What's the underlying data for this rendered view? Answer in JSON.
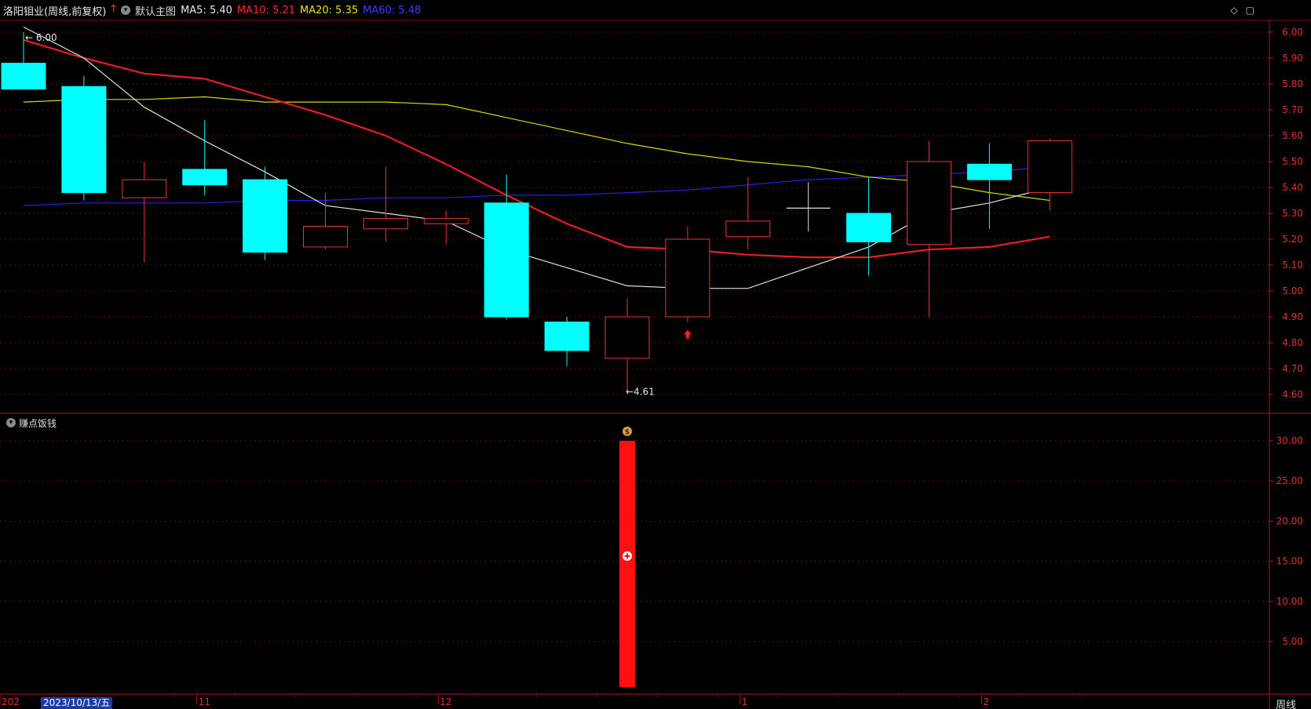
{
  "header": {
    "title": "洛阳钼业(周线,前复权)",
    "template": "默认主图",
    "ma": [
      {
        "label": "MA5: 5.40",
        "color": "#e8e8e8"
      },
      {
        "label": "MA10: 5.21",
        "color": "#ff2a2a"
      },
      {
        "label": "MA20: 5.35",
        "color": "#e6e600"
      },
      {
        "label": "MA60: 5.48",
        "color": "#2b2bff"
      }
    ]
  },
  "sub_header": {
    "title": "赚点饭钱"
  },
  "period_label": "周线",
  "date_cursor": "2023/10/13/五",
  "x_axis": {
    "labels": [
      "202",
      "11",
      "12",
      "1",
      "2"
    ]
  },
  "main_chart": {
    "y_ticks": [
      "6.00",
      "5.90",
      "5.80",
      "5.70",
      "5.60",
      "5.50",
      "5.40",
      "5.30",
      "5.20",
      "5.10",
      "5.00",
      "4.90",
      "4.80",
      "4.70",
      "4.60"
    ],
    "high_label": "6.00",
    "low_label": "4.61"
  },
  "sub_chart": {
    "y_ticks": [
      "30.00",
      "25.00",
      "20.00",
      "15.00",
      "10.00",
      "5.00"
    ]
  },
  "chart_data": {
    "type": "candlestick",
    "candles": [
      {
        "open": 5.88,
        "close": 5.78,
        "high": 6.0,
        "low": 5.78
      },
      {
        "open": 5.79,
        "close": 5.38,
        "high": 5.83,
        "low": 5.35
      },
      {
        "open": 5.36,
        "close": 5.43,
        "high": 5.5,
        "low": 5.11
      },
      {
        "open": 5.47,
        "close": 5.41,
        "high": 5.66,
        "low": 5.37
      },
      {
        "open": 5.43,
        "close": 5.15,
        "high": 5.48,
        "low": 5.12
      },
      {
        "open": 5.17,
        "close": 5.25,
        "high": 5.38,
        "low": 5.16
      },
      {
        "open": 5.24,
        "close": 5.28,
        "high": 5.48,
        "low": 5.19
      },
      {
        "open": 5.26,
        "close": 5.28,
        "high": 5.31,
        "low": 5.18
      },
      {
        "open": 5.34,
        "close": 4.9,
        "high": 5.45,
        "low": 4.89
      },
      {
        "open": 4.88,
        "close": 4.77,
        "high": 4.9,
        "low": 4.71
      },
      {
        "open": 4.74,
        "close": 4.9,
        "high": 4.97,
        "low": 4.61
      },
      {
        "open": 4.9,
        "close": 5.2,
        "high": 5.25,
        "low": 4.88
      },
      {
        "open": 5.21,
        "close": 5.27,
        "high": 5.44,
        "low": 5.16
      },
      {
        "open": 5.32,
        "close": 5.32,
        "high": 5.42,
        "low": 5.23
      },
      {
        "open": 5.3,
        "close": 5.19,
        "high": 5.44,
        "low": 5.06
      },
      {
        "open": 5.18,
        "close": 5.5,
        "high": 5.58,
        "low": 4.9
      },
      {
        "open": 5.49,
        "close": 5.43,
        "high": 5.57,
        "low": 5.24
      },
      {
        "open": 5.38,
        "close": 5.58,
        "high": 5.59,
        "low": 5.31
      }
    ],
    "ma5": [
      6.02,
      5.9,
      5.71,
      5.58,
      5.46,
      5.33,
      5.3,
      5.27,
      5.16,
      5.09,
      5.02,
      5.01,
      5.01,
      5.09,
      5.17,
      5.3,
      5.34,
      5.4
    ],
    "ma10": [
      5.97,
      5.9,
      5.84,
      5.82,
      5.75,
      5.68,
      5.6,
      5.49,
      5.37,
      5.26,
      5.17,
      5.16,
      5.14,
      5.13,
      5.13,
      5.16,
      5.17,
      5.21
    ],
    "ma20": [
      5.73,
      5.74,
      5.74,
      5.75,
      5.73,
      5.73,
      5.73,
      5.72,
      5.67,
      5.62,
      5.57,
      5.53,
      5.5,
      5.48,
      5.44,
      5.42,
      5.38,
      5.35
    ],
    "ma60": [
      5.33,
      5.34,
      5.34,
      5.34,
      5.35,
      5.35,
      5.36,
      5.36,
      5.37,
      5.37,
      5.38,
      5.39,
      5.41,
      5.43,
      5.44,
      5.45,
      5.46,
      5.48
    ],
    "up_arrow_candle": 11,
    "indicator_bar": {
      "candle": 10,
      "value": 30.0
    }
  }
}
